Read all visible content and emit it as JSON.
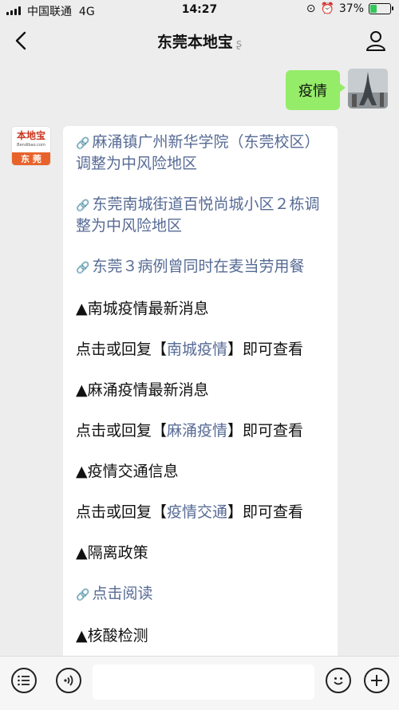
{
  "status": {
    "carrier": "中国联通",
    "network": "4G",
    "time": "14:27",
    "battery_pct": "37%",
    "battery_level": 0.37,
    "battery_color": "#34c759"
  },
  "nav": {
    "title": "东莞本地宝",
    "ear_icon": "ear-icon",
    "back_icon": "chevron-left-icon",
    "profile_icon": "person-icon"
  },
  "user_message": {
    "text": "疫情"
  },
  "bot_avatar": {
    "logo_text": "本地宝",
    "logo_sub": "Bendibao.com",
    "city": "东 莞"
  },
  "bot_message": {
    "items": [
      {
        "type": "link",
        "text": "麻涌镇广州新华学院（东莞校区）调整为中风险地区"
      },
      {
        "type": "link",
        "text": "东莞南城街道百悦尚城小区２栋调整为中风险地区"
      },
      {
        "type": "link",
        "text": "东莞３病例曾同时在麦当劳用餐"
      },
      {
        "type": "text",
        "text": "▲南城疫情最新消息"
      },
      {
        "type": "reply",
        "prefix": "点击或回复【",
        "keyword": "南城疫情",
        "suffix": "】即可查看"
      },
      {
        "type": "text",
        "text": "▲麻涌疫情最新消息"
      },
      {
        "type": "reply",
        "prefix": "点击或回复【",
        "keyword": "麻涌疫情",
        "suffix": "】即可查看"
      },
      {
        "type": "text",
        "text": "▲疫情交通信息"
      },
      {
        "type": "reply",
        "prefix": "点击或回复【",
        "keyword": "疫情交通",
        "suffix": "】即可查看"
      },
      {
        "type": "text",
        "text": "▲隔离政策"
      },
      {
        "type": "link",
        "text": "点击阅读"
      },
      {
        "type": "text",
        "text": "▲核酸检测"
      }
    ]
  },
  "colors": {
    "link": "#576b95",
    "bubble_right": "#95ec69",
    "background": "#ededed"
  }
}
